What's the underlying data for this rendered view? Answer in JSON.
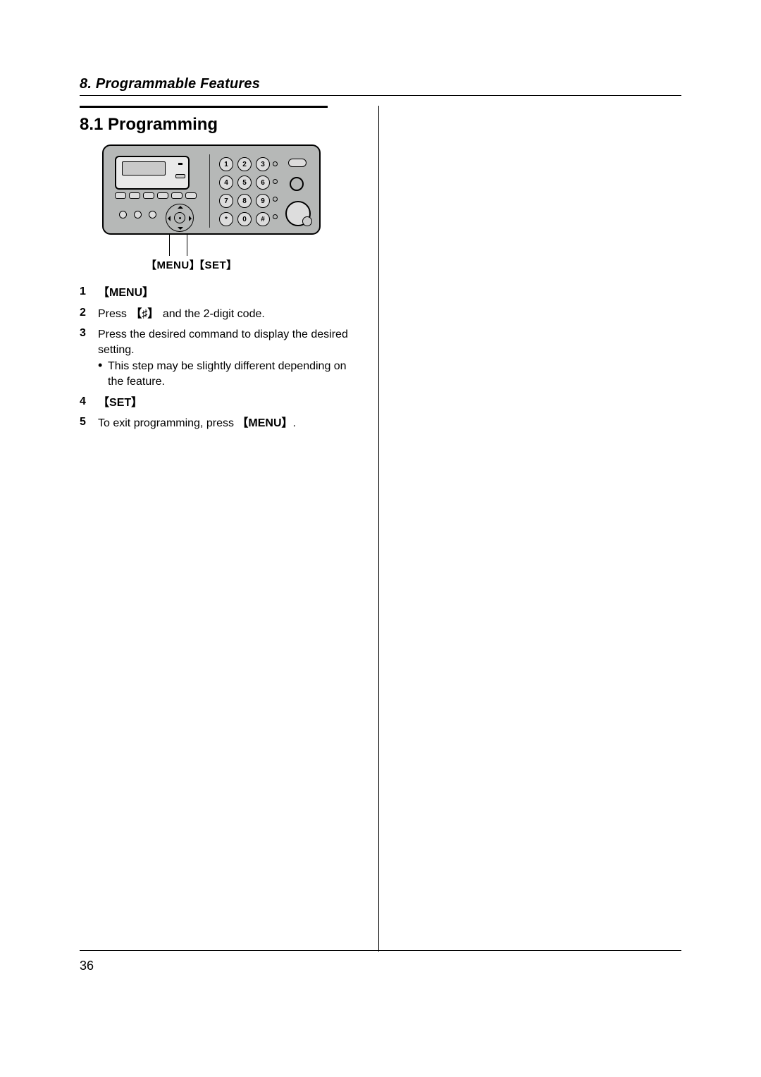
{
  "chapter": {
    "number": "8.",
    "title": "Programmable Features"
  },
  "section": {
    "number": "8.1",
    "title": "Programming"
  },
  "panel": {
    "keypad": [
      "1",
      "2",
      "3",
      "4",
      "5",
      "6",
      "7",
      "8",
      "9",
      "*",
      "0",
      "#"
    ],
    "leader_labels": {
      "menu": "MENU",
      "set": "SET"
    }
  },
  "steps": [
    {
      "num": "1",
      "bold_key": "MENU"
    },
    {
      "num": "2",
      "prefix": "Press ",
      "key": "♯",
      "suffix": " and the 2-digit code."
    },
    {
      "num": "3",
      "text": "Press the desired command to display the desired setting.",
      "sub": "This step may be slightly different depending on the feature."
    },
    {
      "num": "4",
      "bold_key": "SET"
    },
    {
      "num": "5",
      "prefix": "To exit programming, press ",
      "key_bold": "MENU",
      "suffix": "."
    }
  ],
  "page_number": "36"
}
